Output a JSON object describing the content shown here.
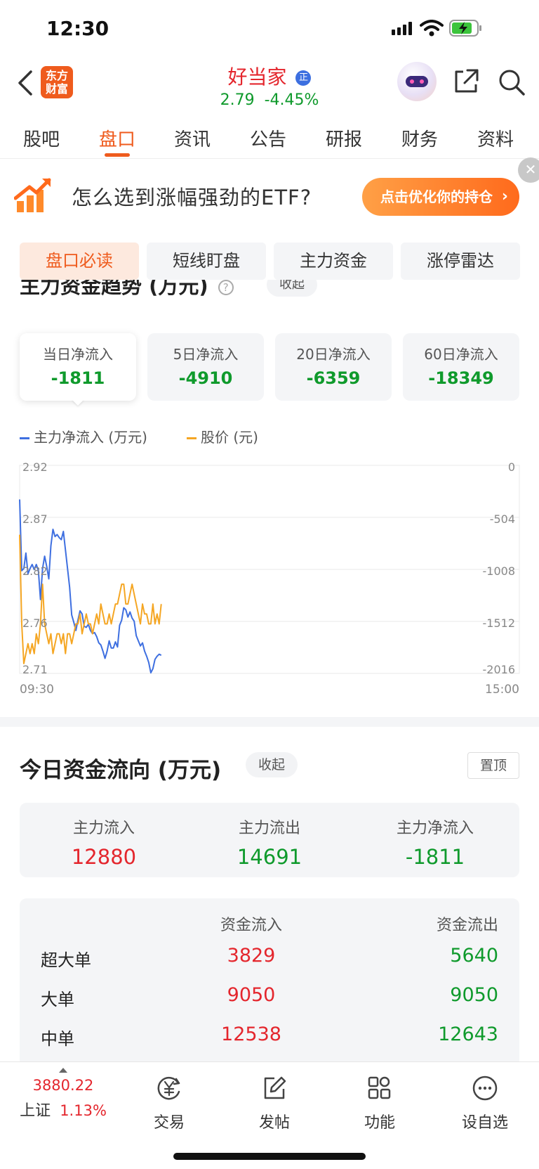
{
  "status_bar": {
    "time": "12:30"
  },
  "header": {
    "logo_text_1": "东方",
    "logo_text_2": "财富",
    "stock_name": "好当家",
    "badge": "正",
    "price": "2.79",
    "change_pct": "-4.45%"
  },
  "tabs": [
    "股吧",
    "盘口",
    "资讯",
    "公告",
    "研报",
    "财务",
    "资料"
  ],
  "active_tab": "盘口",
  "banner": {
    "text": "怎么选到涨幅强劲的ETF?",
    "button_label": "点击优化你的持仓"
  },
  "subtabs": [
    "盘口必读",
    "短线盯盘",
    "主力资金",
    "涨停雷达"
  ],
  "trend_section": {
    "title": "主力资金趋势 (万元)",
    "collapse_label": "收起",
    "cards": [
      {
        "label": "当日净流入",
        "value": "-1811"
      },
      {
        "label": "5日净流入",
        "value": "-4910"
      },
      {
        "label": "20日净流入",
        "value": "-6359"
      },
      {
        "label": "60日净流入",
        "value": "-18349"
      }
    ],
    "legend": {
      "series1": "主力净流入 (万元)",
      "series2": "股价 (元)"
    }
  },
  "chart_data": {
    "type": "line",
    "title": "",
    "x_start_label": "09:30",
    "x_end_label": "15:00",
    "left_axis_ticks": [
      "2.92",
      "2.87",
      "2.82",
      "2.76",
      "2.71"
    ],
    "right_axis_ticks": [
      "0",
      "-504",
      "-1008",
      "-1512",
      "-2016"
    ],
    "left_range": [
      2.71,
      2.92
    ],
    "right_range": [
      -2016,
      0
    ],
    "colors": {
      "inflow": "#3e6fe0",
      "price": "#f5a623",
      "grid": "#e8e8e8"
    },
    "series": [
      {
        "name": "主力净流入 (万元)",
        "axis": "right",
        "values": [
          -330,
          -1020,
          -1000,
          -850,
          -1050,
          -1000,
          -960,
          -1010,
          -960,
          -1020,
          -1300,
          -1000,
          -880,
          -980,
          -1100,
          -780,
          -620,
          -690,
          -670,
          -700,
          -720,
          -640,
          -820,
          -1000,
          -1180,
          -1450,
          -1520,
          -1600,
          -1500,
          -1410,
          -1440,
          -1560,
          -1570,
          -1540,
          -1600,
          -1630,
          -1620,
          -1660,
          -1720,
          -1740,
          -1800,
          -1870,
          -1800,
          -1700,
          -1770,
          -1770,
          -1710,
          -1760,
          -1550,
          -1500,
          -1380,
          -1400,
          -1470,
          -1420,
          -1480,
          -1510,
          -1650,
          -1700,
          -1750,
          -1720,
          -1800,
          -1850,
          -1910,
          -2010,
          -1970,
          -1880,
          -1850,
          -1830,
          -1840
        ]
      },
      {
        "name": "股价 (元)",
        "axis": "left",
        "values": [
          2.85,
          2.76,
          2.72,
          2.73,
          2.74,
          2.73,
          2.74,
          2.73,
          2.75,
          2.74,
          2.76,
          2.8,
          2.76,
          2.75,
          2.74,
          2.75,
          2.73,
          2.74,
          2.75,
          2.75,
          2.74,
          2.75,
          2.73,
          2.75,
          2.75,
          2.74,
          2.75,
          2.76,
          2.76,
          2.77,
          2.75,
          2.76,
          2.77,
          2.76,
          2.76,
          2.75,
          2.76,
          2.77,
          2.76,
          2.78,
          2.77,
          2.76,
          2.76,
          2.77,
          2.76,
          2.77,
          2.78,
          2.78,
          2.79,
          2.8,
          2.8,
          2.78,
          2.78,
          2.79,
          2.8,
          2.79,
          2.78,
          2.77,
          2.76,
          2.78,
          2.77,
          2.77,
          2.76,
          2.76,
          2.78,
          2.76,
          2.77,
          2.76,
          2.78
        ]
      }
    ]
  },
  "flow_section": {
    "title": "今日资金流向 (万元)",
    "collapse_label": "收起",
    "pin_label": "置顶",
    "summary": [
      {
        "label": "主力流入",
        "value": "12880"
      },
      {
        "label": "主力流出",
        "value": "14691"
      },
      {
        "label": "主力净流入",
        "value": "-1811"
      }
    ],
    "table_headers": {
      "inflow": "资金流入",
      "outflow": "资金流出"
    },
    "rows": [
      {
        "name": "超大单",
        "inflow": "3829",
        "outflow": "5640"
      },
      {
        "name": "大单",
        "inflow": "9050",
        "outflow": "9050"
      },
      {
        "name": "中单",
        "inflow": "12538",
        "outflow": "12643"
      }
    ]
  },
  "bottom_nav": {
    "index_value": "3880.22",
    "index_name": "上证",
    "index_change": "1.13%",
    "items": [
      "交易",
      "发帖",
      "功能",
      "设自选"
    ]
  }
}
